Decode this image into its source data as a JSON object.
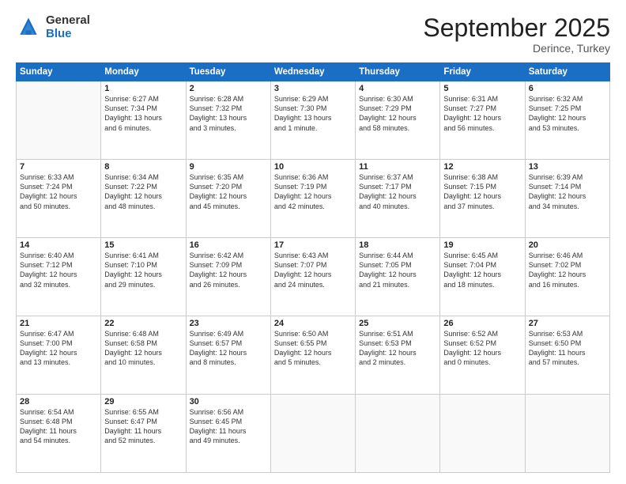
{
  "logo": {
    "general": "General",
    "blue": "Blue"
  },
  "header": {
    "month": "September 2025",
    "location": "Derince, Turkey"
  },
  "days_of_week": [
    "Sunday",
    "Monday",
    "Tuesday",
    "Wednesday",
    "Thursday",
    "Friday",
    "Saturday"
  ],
  "weeks": [
    [
      {
        "num": "",
        "info": ""
      },
      {
        "num": "1",
        "info": "Sunrise: 6:27 AM\nSunset: 7:34 PM\nDaylight: 13 hours\nand 6 minutes."
      },
      {
        "num": "2",
        "info": "Sunrise: 6:28 AM\nSunset: 7:32 PM\nDaylight: 13 hours\nand 3 minutes."
      },
      {
        "num": "3",
        "info": "Sunrise: 6:29 AM\nSunset: 7:30 PM\nDaylight: 13 hours\nand 1 minute."
      },
      {
        "num": "4",
        "info": "Sunrise: 6:30 AM\nSunset: 7:29 PM\nDaylight: 12 hours\nand 58 minutes."
      },
      {
        "num": "5",
        "info": "Sunrise: 6:31 AM\nSunset: 7:27 PM\nDaylight: 12 hours\nand 56 minutes."
      },
      {
        "num": "6",
        "info": "Sunrise: 6:32 AM\nSunset: 7:25 PM\nDaylight: 12 hours\nand 53 minutes."
      }
    ],
    [
      {
        "num": "7",
        "info": "Sunrise: 6:33 AM\nSunset: 7:24 PM\nDaylight: 12 hours\nand 50 minutes."
      },
      {
        "num": "8",
        "info": "Sunrise: 6:34 AM\nSunset: 7:22 PM\nDaylight: 12 hours\nand 48 minutes."
      },
      {
        "num": "9",
        "info": "Sunrise: 6:35 AM\nSunset: 7:20 PM\nDaylight: 12 hours\nand 45 minutes."
      },
      {
        "num": "10",
        "info": "Sunrise: 6:36 AM\nSunset: 7:19 PM\nDaylight: 12 hours\nand 42 minutes."
      },
      {
        "num": "11",
        "info": "Sunrise: 6:37 AM\nSunset: 7:17 PM\nDaylight: 12 hours\nand 40 minutes."
      },
      {
        "num": "12",
        "info": "Sunrise: 6:38 AM\nSunset: 7:15 PM\nDaylight: 12 hours\nand 37 minutes."
      },
      {
        "num": "13",
        "info": "Sunrise: 6:39 AM\nSunset: 7:14 PM\nDaylight: 12 hours\nand 34 minutes."
      }
    ],
    [
      {
        "num": "14",
        "info": "Sunrise: 6:40 AM\nSunset: 7:12 PM\nDaylight: 12 hours\nand 32 minutes."
      },
      {
        "num": "15",
        "info": "Sunrise: 6:41 AM\nSunset: 7:10 PM\nDaylight: 12 hours\nand 29 minutes."
      },
      {
        "num": "16",
        "info": "Sunrise: 6:42 AM\nSunset: 7:09 PM\nDaylight: 12 hours\nand 26 minutes."
      },
      {
        "num": "17",
        "info": "Sunrise: 6:43 AM\nSunset: 7:07 PM\nDaylight: 12 hours\nand 24 minutes."
      },
      {
        "num": "18",
        "info": "Sunrise: 6:44 AM\nSunset: 7:05 PM\nDaylight: 12 hours\nand 21 minutes."
      },
      {
        "num": "19",
        "info": "Sunrise: 6:45 AM\nSunset: 7:04 PM\nDaylight: 12 hours\nand 18 minutes."
      },
      {
        "num": "20",
        "info": "Sunrise: 6:46 AM\nSunset: 7:02 PM\nDaylight: 12 hours\nand 16 minutes."
      }
    ],
    [
      {
        "num": "21",
        "info": "Sunrise: 6:47 AM\nSunset: 7:00 PM\nDaylight: 12 hours\nand 13 minutes."
      },
      {
        "num": "22",
        "info": "Sunrise: 6:48 AM\nSunset: 6:58 PM\nDaylight: 12 hours\nand 10 minutes."
      },
      {
        "num": "23",
        "info": "Sunrise: 6:49 AM\nSunset: 6:57 PM\nDaylight: 12 hours\nand 8 minutes."
      },
      {
        "num": "24",
        "info": "Sunrise: 6:50 AM\nSunset: 6:55 PM\nDaylight: 12 hours\nand 5 minutes."
      },
      {
        "num": "25",
        "info": "Sunrise: 6:51 AM\nSunset: 6:53 PM\nDaylight: 12 hours\nand 2 minutes."
      },
      {
        "num": "26",
        "info": "Sunrise: 6:52 AM\nSunset: 6:52 PM\nDaylight: 12 hours\nand 0 minutes."
      },
      {
        "num": "27",
        "info": "Sunrise: 6:53 AM\nSunset: 6:50 PM\nDaylight: 11 hours\nand 57 minutes."
      }
    ],
    [
      {
        "num": "28",
        "info": "Sunrise: 6:54 AM\nSunset: 6:48 PM\nDaylight: 11 hours\nand 54 minutes."
      },
      {
        "num": "29",
        "info": "Sunrise: 6:55 AM\nSunset: 6:47 PM\nDaylight: 11 hours\nand 52 minutes."
      },
      {
        "num": "30",
        "info": "Sunrise: 6:56 AM\nSunset: 6:45 PM\nDaylight: 11 hours\nand 49 minutes."
      },
      {
        "num": "",
        "info": ""
      },
      {
        "num": "",
        "info": ""
      },
      {
        "num": "",
        "info": ""
      },
      {
        "num": "",
        "info": ""
      }
    ]
  ]
}
